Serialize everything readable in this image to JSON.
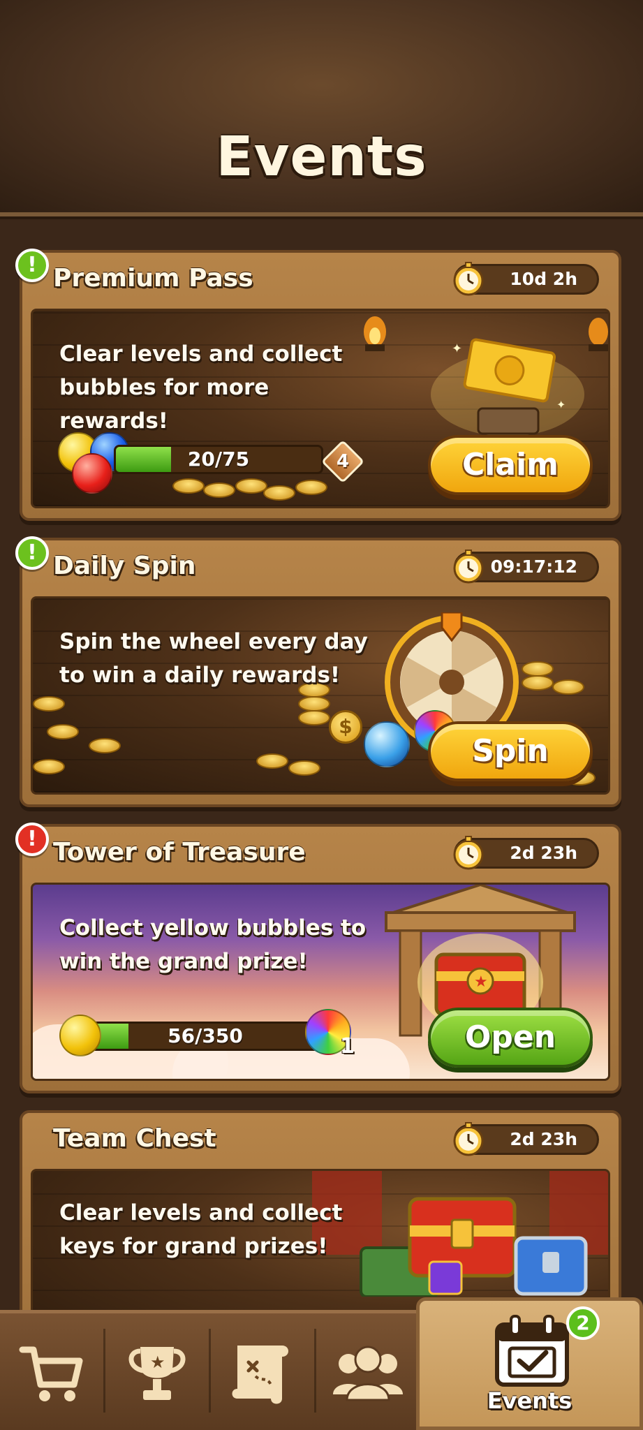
{
  "header": {
    "title": "Events"
  },
  "events": [
    {
      "title": "Premium Pass",
      "alert": "!",
      "timer": "10d 2h",
      "description": "Clear levels and collect bubbles for more rewards!",
      "progress_text": "20/75",
      "progress_fraction": 0.27,
      "tier_badge": "4",
      "button_label": "Claim"
    },
    {
      "title": "Daily Spin",
      "alert": "!",
      "timer": "09:17:12",
      "description": "Spin the wheel every day to win a daily rewards!",
      "button_label": "Spin"
    },
    {
      "title": "Tower of Treasure",
      "alert": "!",
      "timer": "2d 23h",
      "description": "Collect yellow bubbles to win the grand prize!",
      "progress_text": "56/350",
      "progress_fraction": 0.16,
      "reward_count": "1",
      "button_label": "Open"
    },
    {
      "title": "Team Chest",
      "timer": "2d 23h",
      "description": "Clear levels and collect keys for grand prizes!"
    }
  ],
  "bottom_nav": {
    "items": [
      {
        "icon": "cart-icon"
      },
      {
        "icon": "trophy-icon"
      },
      {
        "icon": "treasure-map-icon"
      },
      {
        "icon": "team-icon"
      }
    ],
    "active": {
      "icon": "calendar-check-icon",
      "label": "Events",
      "badge": "2"
    }
  },
  "colors": {
    "button_yellow": "#f0a60e",
    "button_green": "#55a515",
    "alert_green": "#6cc11e",
    "alert_red": "#e23024",
    "card_wood": "#b68449"
  }
}
